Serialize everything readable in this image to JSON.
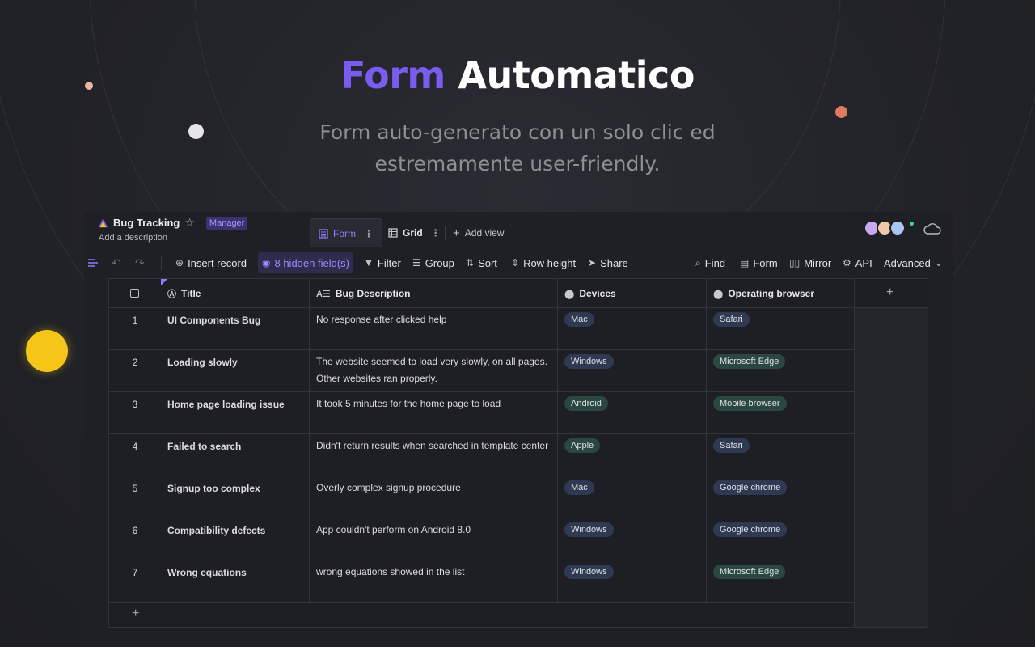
{
  "hero": {
    "title_accent": "Form",
    "title_rest": "Automatico",
    "subtitle_line1": "Form auto-generato con un solo clic ed",
    "subtitle_line2": "estremamente user-friendly."
  },
  "colors": {
    "accent": "#7b5cf0",
    "manager_badge_bg": "#3b3370",
    "hidden_fields_bg": "#2f2b4d",
    "tag_blue": "#2f3a52",
    "tag_green": "#2a4740",
    "yellow_dot": "#f5c518",
    "orange_dot": "#e07a5f"
  },
  "datasheet": {
    "name": "Bug Tracking",
    "role": "Manager",
    "description": "Add a description"
  },
  "tabs": [
    {
      "label": "Form",
      "icon": "form-icon",
      "active": true
    },
    {
      "label": "Grid",
      "icon": "grid-icon",
      "active": false
    }
  ],
  "add_view": "Add view",
  "toolbar": {
    "insert_record": "Insert record",
    "hidden_fields": "8 hidden field(s)",
    "filter": "Filter",
    "group": "Group",
    "sort": "Sort",
    "row_height": "Row height",
    "share": "Share",
    "find": "Find",
    "form": "Form",
    "mirror": "Mirror",
    "api": "API",
    "advanced": "Advanced"
  },
  "columns": [
    "Title",
    "Bug Description",
    "Devices",
    "Operating browser"
  ],
  "rows": [
    {
      "num": "1",
      "title": "UI Components Bug",
      "desc": "No response after clicked help",
      "device": "Mac",
      "browser": "Safari"
    },
    {
      "num": "2",
      "title": "Loading slowly",
      "desc": "The website seemed to load very slowly, on all pages.  Other websites ran properly.",
      "device": "Windows",
      "browser": "Microsoft Edge"
    },
    {
      "num": "3",
      "title": "Home page loading issue",
      "desc": "It took 5 minutes for the home page to load",
      "device": "Android",
      "browser": "Mobile browser"
    },
    {
      "num": "4",
      "title": "Failed to search",
      "desc": "Didn't return results when searched in template center",
      "device": "Apple",
      "browser": "Safari"
    },
    {
      "num": "5",
      "title": "Signup too complex",
      "desc": "Overly complex signup procedure",
      "device": "Mac",
      "browser": "Google chrome"
    },
    {
      "num": "6",
      "title": "Compatibility defects",
      "desc": "App couldn't perform on Android 8.0",
      "device": "Windows",
      "browser": "Google chrome"
    },
    {
      "num": "7",
      "title": "Wrong equations",
      "desc": "wrong equations showed in the list",
      "device": "Windows",
      "browser": "Microsoft Edge"
    }
  ]
}
